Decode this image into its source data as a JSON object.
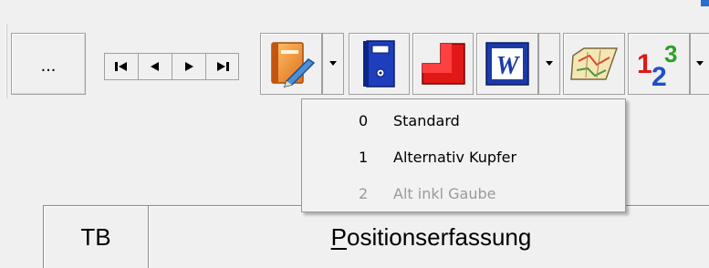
{
  "toolbar": {
    "ellipsis_label": "...",
    "nav_buttons": [
      {
        "name": "first-record-icon"
      },
      {
        "name": "previous-record-icon"
      },
      {
        "name": "next-record-icon"
      },
      {
        "name": "last-record-icon"
      }
    ],
    "tools": [
      {
        "name": "edit-book-icon",
        "has_dropdown": true
      },
      {
        "name": "binder-icon",
        "has_dropdown": false
      },
      {
        "name": "corner-shape-icon",
        "has_dropdown": false
      },
      {
        "name": "word-document-icon",
        "has_dropdown": true
      },
      {
        "name": "map-icon",
        "has_dropdown": false
      },
      {
        "name": "numbering-123-icon",
        "has_dropdown": true
      }
    ]
  },
  "dropdown_menu": {
    "items": [
      {
        "num": "0",
        "label": "Standard",
        "enabled": true
      },
      {
        "num": "1",
        "label": "Alternativ Kupfer",
        "enabled": true
      },
      {
        "num": "2",
        "label": "Alt inkl Gaube",
        "enabled": false
      }
    ]
  },
  "table_header": {
    "col_tb": "TB",
    "col_pos_mnemonic": "P",
    "col_pos_rest": "ositionserfassung"
  },
  "colors": {
    "accent_blue": "#2a6fd0",
    "window_bg": "#f0f0f0",
    "disabled_text": "#9a9a9a"
  }
}
